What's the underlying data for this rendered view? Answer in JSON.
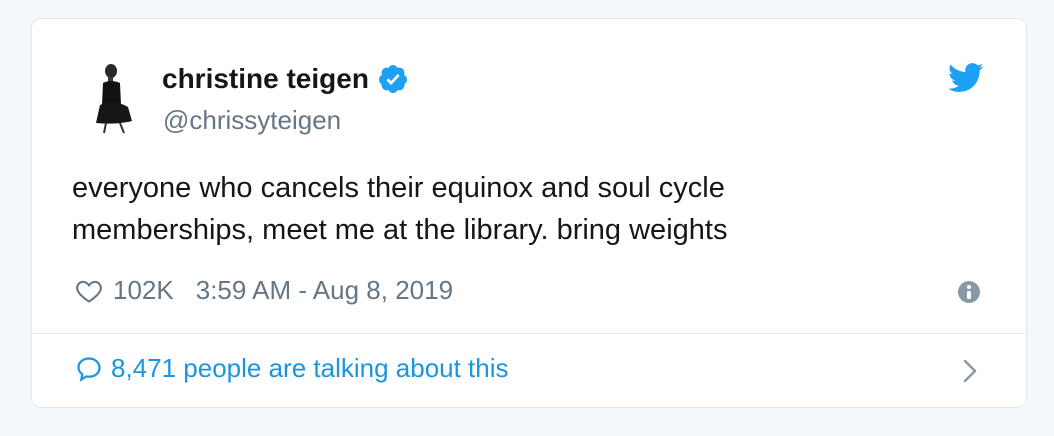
{
  "tweet": {
    "author_name": "christine teigen",
    "handle": "@chrissyteigen",
    "text_line1": "everyone who cancels their equinox and soul cycle",
    "text_line2": "memberships, meet me at the library. bring weights",
    "likes": "102K",
    "timestamp": "3:59 AM - Aug 8, 2019",
    "conversation": "8,471 people are talking about this"
  },
  "icons": {
    "verified": "verified-badge-icon",
    "brand": "twitter-bird-icon",
    "like": "heart-icon",
    "info": "info-icon",
    "reply": "speech-bubble-icon",
    "more": "chevron-right-icon"
  },
  "colors": {
    "twitter_blue": "#1da1f2",
    "link_blue": "#1b95e0",
    "secondary_text": "#657786",
    "primary_text": "#14171a",
    "border": "#e1e8ed"
  }
}
